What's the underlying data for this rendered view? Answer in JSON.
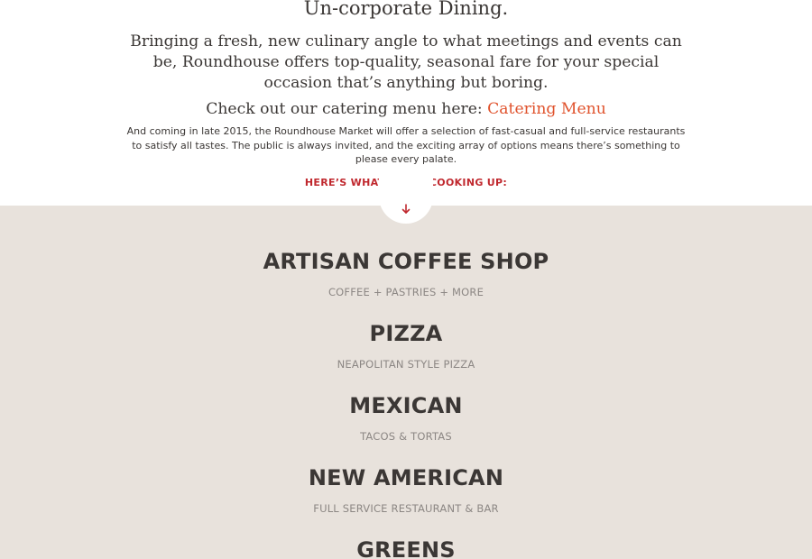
{
  "intro": {
    "headline": "Un-corporate Dining.",
    "lead": "Bringing a fresh, new culinary angle to what meetings and events can be, Roundhouse offers top-quality, seasonal fare for your special occasion that’s anything but boring.",
    "catering_prefix": "Check out our catering menu here: ",
    "catering_link": "Catering Menu",
    "body": "And coming in late 2015, the Roundhouse Market will offer a selection of fast-casual and full-service restaurants to satisfy all tastes. The public is always invited, and the exciting array of options means there’s something to please every palate.",
    "cooking_label": "HERE’S WHAT WE’RE COOKING UP:"
  },
  "scroll": {
    "icon": "arrow-down-icon"
  },
  "venues": [
    {
      "title": "ARTISAN COFFEE SHOP",
      "subtitle": "COFFEE + PASTRIES + MORE"
    },
    {
      "title": "PIZZA",
      "subtitle": "NEAPOLITAN STYLE PIZZA"
    },
    {
      "title": "MEXICAN",
      "subtitle": "TACOS & TORTAS"
    },
    {
      "title": "NEW AMERICAN",
      "subtitle": "FULL SERVICE RESTAURANT & BAR"
    },
    {
      "title": "GREENS",
      "subtitle": ""
    }
  ],
  "colors": {
    "text": "#3b3735",
    "link": "#e0522c",
    "accent_red": "#c0282e",
    "muted": "#8c8784",
    "menu_background": "#e8e2dc"
  }
}
